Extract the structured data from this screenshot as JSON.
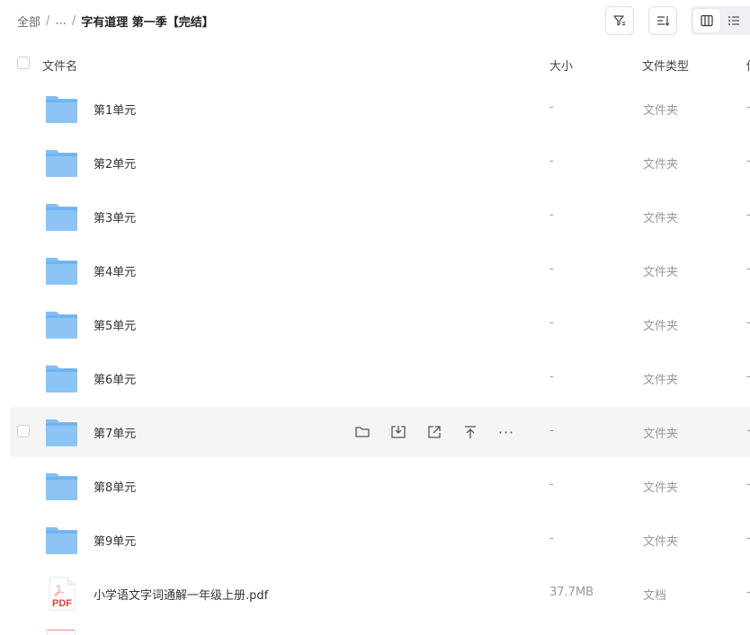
{
  "breadcrumb": {
    "root": "全部",
    "sep": "/",
    "ellipsis": "...",
    "current": "字有道理 第一季【完结】"
  },
  "toolbar": {
    "filter_icon": "filter-icon",
    "sort_icon": "sort-icon",
    "grid_view_icon": "grid-view-icon",
    "list_view_icon": "list-view-icon"
  },
  "table": {
    "headers": {
      "name": "文件名",
      "size": "大小",
      "type": "文件类型",
      "extra": "修"
    },
    "rows": [
      {
        "name": "第1单元",
        "size": "-",
        "type": "文件夹",
        "extra": "-",
        "kind": "folder"
      },
      {
        "name": "第2单元",
        "size": "-",
        "type": "文件夹",
        "extra": "-",
        "kind": "folder"
      },
      {
        "name": "第3单元",
        "size": "-",
        "type": "文件夹",
        "extra": "-",
        "kind": "folder"
      },
      {
        "name": "第4单元",
        "size": "-",
        "type": "文件夹",
        "extra": "-",
        "kind": "folder"
      },
      {
        "name": "第5单元",
        "size": "-",
        "type": "文件夹",
        "extra": "-",
        "kind": "folder"
      },
      {
        "name": "第6单元",
        "size": "-",
        "type": "文件夹",
        "extra": "-",
        "kind": "folder"
      },
      {
        "name": "第7单元",
        "size": "-",
        "type": "文件夹",
        "extra": "-",
        "kind": "folder"
      },
      {
        "name": "第8单元",
        "size": "-",
        "type": "文件夹",
        "extra": "-",
        "kind": "folder"
      },
      {
        "name": "第9单元",
        "size": "-",
        "type": "文件夹",
        "extra": "-",
        "kind": "folder"
      },
      {
        "name": "小学语文字词通解一年级上册.pdf",
        "size": "37.7MB",
        "type": "文档",
        "extra": "-",
        "kind": "pdf",
        "badge": "PDF"
      }
    ],
    "hover_actions": [
      "open-folder-icon",
      "download-icon",
      "share-icon",
      "move-to-top-icon",
      "more-icon"
    ],
    "more_glyph": "···"
  },
  "colors": {
    "folder": "#6fb3f1",
    "pdf": "#e0443b",
    "hover_row": "#f5f5f6"
  }
}
